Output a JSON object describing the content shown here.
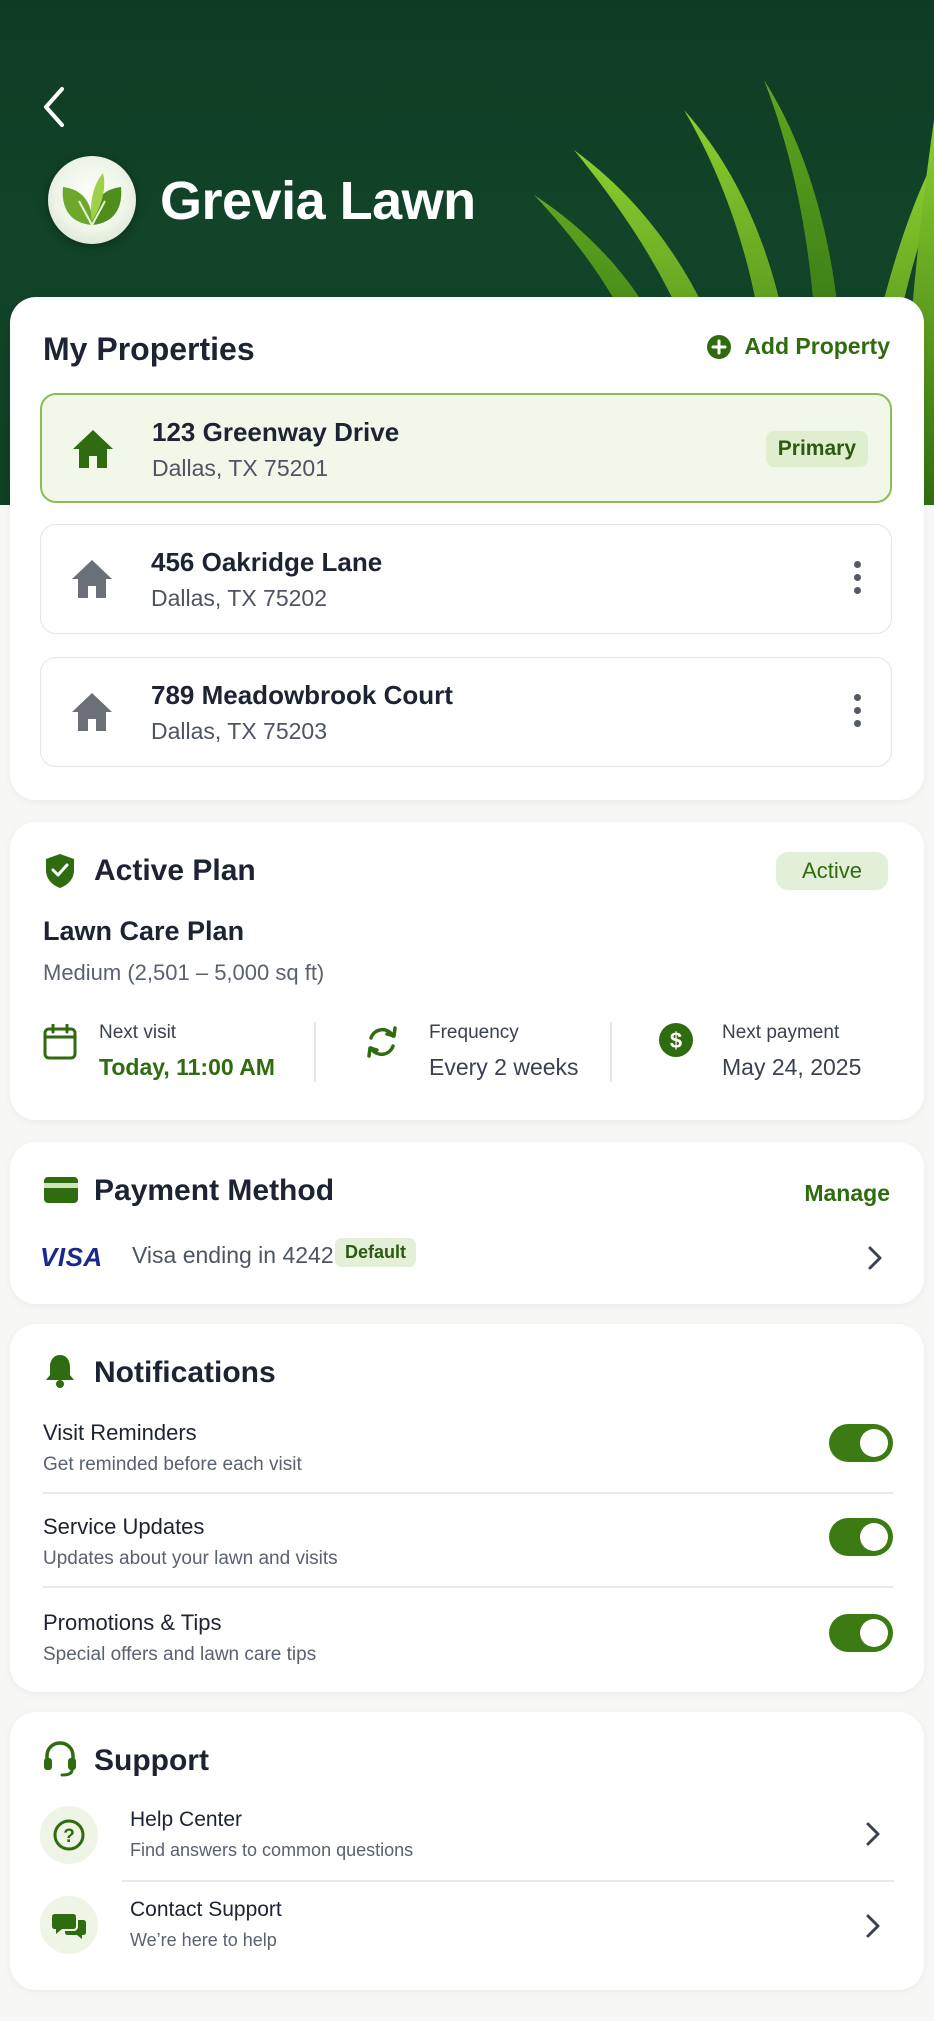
{
  "app": {
    "title": "Grevia Lawn"
  },
  "properties": {
    "title": "My Properties",
    "add_label": "Add Property",
    "items": [
      {
        "address": "123 Greenway Drive",
        "city": "Dallas, TX 75201",
        "badge": "Primary",
        "primary": true
      },
      {
        "address": "456 Oakridge Lane",
        "city": "Dallas, TX 75202",
        "primary": false
      },
      {
        "address": "789 Meadowbrook Court",
        "city": "Dallas, TX 75203",
        "primary": false
      }
    ]
  },
  "plan": {
    "title": "Active Plan",
    "status": "Active",
    "name": "Lawn Care Plan",
    "size": "Medium (2,501 – 5,000 sq ft)",
    "next_visit_label": "Next visit",
    "next_visit_value": "Today, 11:00 AM",
    "frequency_label": "Frequency",
    "frequency_value": "Every 2 weeks",
    "next_payment_label": "Next payment",
    "next_payment_value": "May 24, 2025"
  },
  "payment": {
    "title": "Payment Method",
    "manage_label": "Manage",
    "brand": "VISA",
    "card_text": "Visa ending in 4242",
    "default_badge": "Default"
  },
  "notifications": {
    "title": "Notifications",
    "items": [
      {
        "title": "Visit Reminders",
        "subtitle": "Get reminded before each visit",
        "enabled": true
      },
      {
        "title": "Service Updates",
        "subtitle": "Updates about your lawn and visits",
        "enabled": true
      },
      {
        "title": "Promotions & Tips",
        "subtitle": "Special offers and lawn care tips",
        "enabled": true
      }
    ]
  },
  "support": {
    "title": "Support",
    "items": [
      {
        "title": "Help Center",
        "subtitle": "Find answers to common questions",
        "icon": "question-icon"
      },
      {
        "title": "Contact Support",
        "subtitle": "We’re here to help",
        "icon": "chat-icon"
      }
    ]
  },
  "colors": {
    "header_bg": "#114429",
    "accent": "#2f6b0f",
    "toggle_on": "#3c7a14",
    "primary_card_bg": "#f2f8e9"
  }
}
